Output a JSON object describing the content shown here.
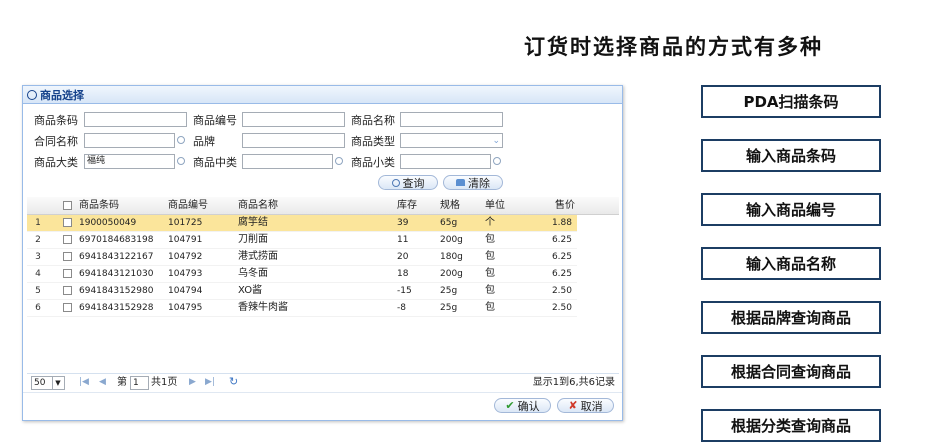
{
  "headline": "订货时选择商品的方式有多种",
  "options": [
    "PDA扫描条码",
    "输入商品条码",
    "输入商品编号",
    "输入商品名称",
    "根据品牌查询商品",
    "根据合同查询商品",
    "根据分类查询商品"
  ],
  "dialog": {
    "title": "商品选择",
    "form": {
      "barcode_label": "商品条码",
      "code_label": "商品编号",
      "name_label": "商品名称",
      "contract_label": "合同名称",
      "brand_label": "品牌",
      "type_label": "商品类型",
      "major_label": "商品大类",
      "major_value": "福纯",
      "middle_label": "商品中类",
      "minor_label": "商品小类",
      "search_button": "查询",
      "clear_button": "清除"
    },
    "grid": {
      "headers": {
        "barcode": "商品条码",
        "code": "商品编号",
        "name": "商品名称",
        "stock": "库存",
        "spec": "规格",
        "unit": "单位",
        "price": "售价"
      },
      "rows": [
        {
          "no": "1",
          "barcode": "1900050049",
          "code": "101725",
          "name": "腐竽结",
          "stock": "39",
          "spec": "65g",
          "unit": "个",
          "price": "1.88"
        },
        {
          "no": "2",
          "barcode": "6970184683198",
          "code": "104791",
          "name": "刀削面",
          "stock": "11",
          "spec": "200g",
          "unit": "包",
          "price": "6.25"
        },
        {
          "no": "3",
          "barcode": "6941843122167",
          "code": "104792",
          "name": "港式捞面",
          "stock": "20",
          "spec": "180g",
          "unit": "包",
          "price": "6.25"
        },
        {
          "no": "4",
          "barcode": "6941843121030",
          "code": "104793",
          "name": "乌冬面",
          "stock": "18",
          "spec": "200g",
          "unit": "包",
          "price": "6.25"
        },
        {
          "no": "5",
          "barcode": "6941843152980",
          "code": "104794",
          "name": "XO酱",
          "stock": "-15",
          "spec": "25g",
          "unit": "包",
          "price": "2.50"
        },
        {
          "no": "6",
          "barcode": "6941843152928",
          "code": "104795",
          "name": "香辣牛肉酱",
          "stock": "-8",
          "spec": "25g",
          "unit": "包",
          "price": "2.50"
        }
      ]
    },
    "pager": {
      "page_size": "50",
      "page_prefix": "第",
      "page_value": "1",
      "page_suffix": "共1页",
      "summary": "显示1到6,共6记录"
    },
    "confirm_button": "确认",
    "cancel_button": "取消"
  }
}
